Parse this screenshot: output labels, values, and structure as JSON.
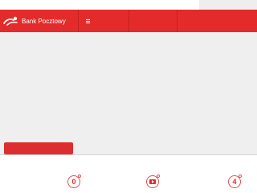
{
  "header": {
    "brand_name": "Bank Pocztowy",
    "logo_icon": "bank-pocztowy-logo-icon",
    "menu_icon": "hamburger-menu-icon"
  },
  "footer": {
    "social_links": [
      {
        "icon": "social-zero-icon",
        "label": "0"
      },
      {
        "icon": "youtube-icon",
        "label": ""
      },
      {
        "icon": "social-four-icon",
        "label": "4"
      }
    ]
  },
  "colors": {
    "brand_red": "#e42b2b",
    "hero_gray": "#efefef",
    "button_red": "#dc2e2e"
  }
}
